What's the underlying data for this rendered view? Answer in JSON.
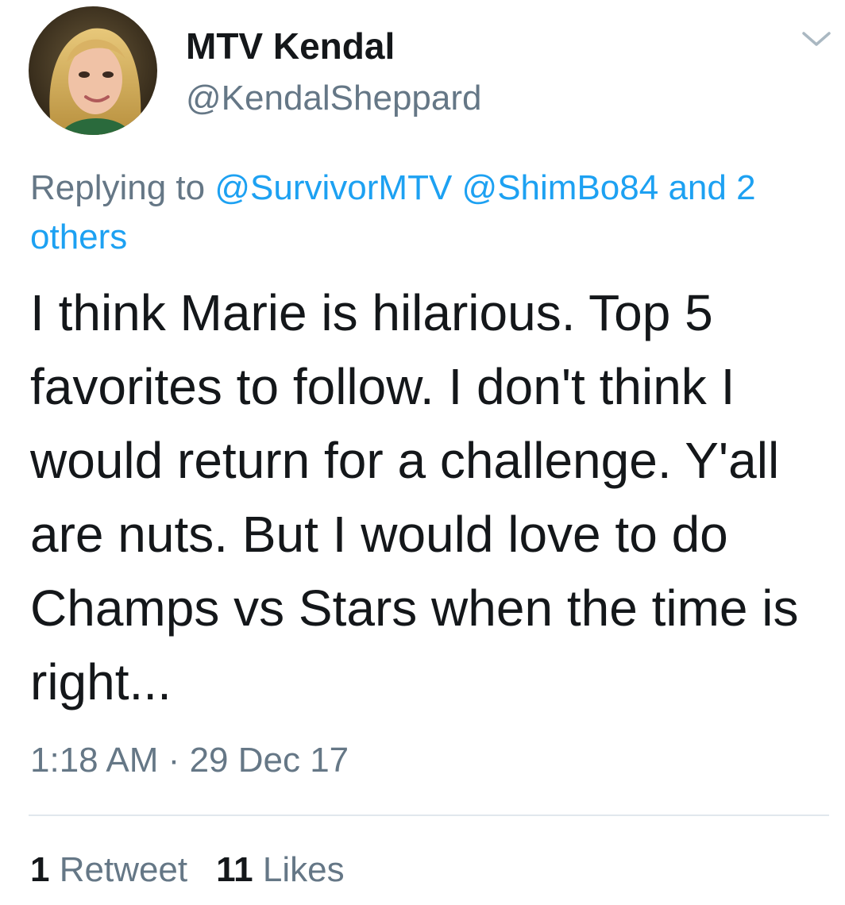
{
  "tweet": {
    "author": {
      "display_name": "MTV Kendal",
      "handle": "@KendalSheppard",
      "avatar_icon": "profile-photo"
    },
    "menu_icon": "chevron-down-icon",
    "reply": {
      "prefix": "Replying to",
      "mentions": [
        "@SurvivorMTV",
        "@ShimBo84"
      ],
      "suffix": "and 2 others"
    },
    "text": "I think Marie is hilarious. Top 5 favorites to follow. I don't think I would return for a challenge. Y'all are nuts. But I would love to do Champs vs Stars when the time is right...",
    "time": "1:18 AM",
    "separator": "·",
    "date": "29 Dec 17",
    "retweets": {
      "count": "1",
      "label": "Retweet"
    },
    "likes": {
      "count": "11",
      "label": "Likes"
    }
  },
  "colors": {
    "text": "#14171a",
    "secondary": "#657786",
    "link": "#1da1f2",
    "divider": "#e1e8ed"
  }
}
